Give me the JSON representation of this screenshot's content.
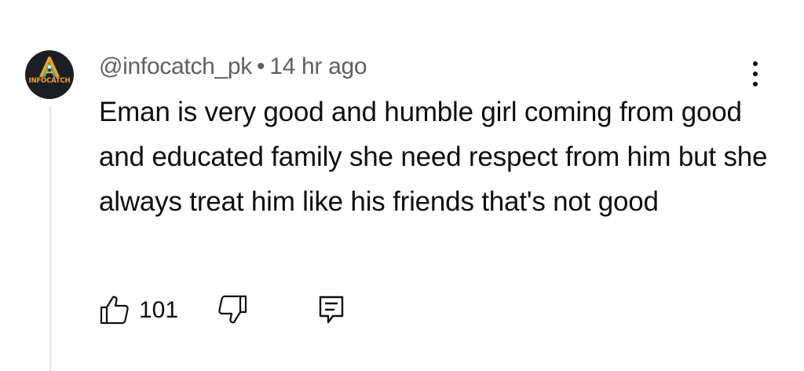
{
  "comment": {
    "author": "@infocatch_pk",
    "separator": "•",
    "time": "14 hr ago",
    "text": "Eman is very good and humble girl coming from good and educated family she need respect from him but she always treat him like his friends that's not good",
    "like_count": "101"
  },
  "avatar": {
    "label": "INFOCATCH",
    "icon": "infocatch-logo",
    "colors": {
      "background": "#1c1e26",
      "accent": "#f0a21b",
      "teal": "#2bb5a3"
    }
  },
  "icons": {
    "more": "more-vertical-icon",
    "like": "thumbs-up-icon",
    "dislike": "thumbs-down-icon",
    "reply": "reply-comment-icon"
  },
  "colors": {
    "text": "#0f0f0f",
    "secondary_text": "#606060",
    "thread_line": "#e5e5e5"
  }
}
